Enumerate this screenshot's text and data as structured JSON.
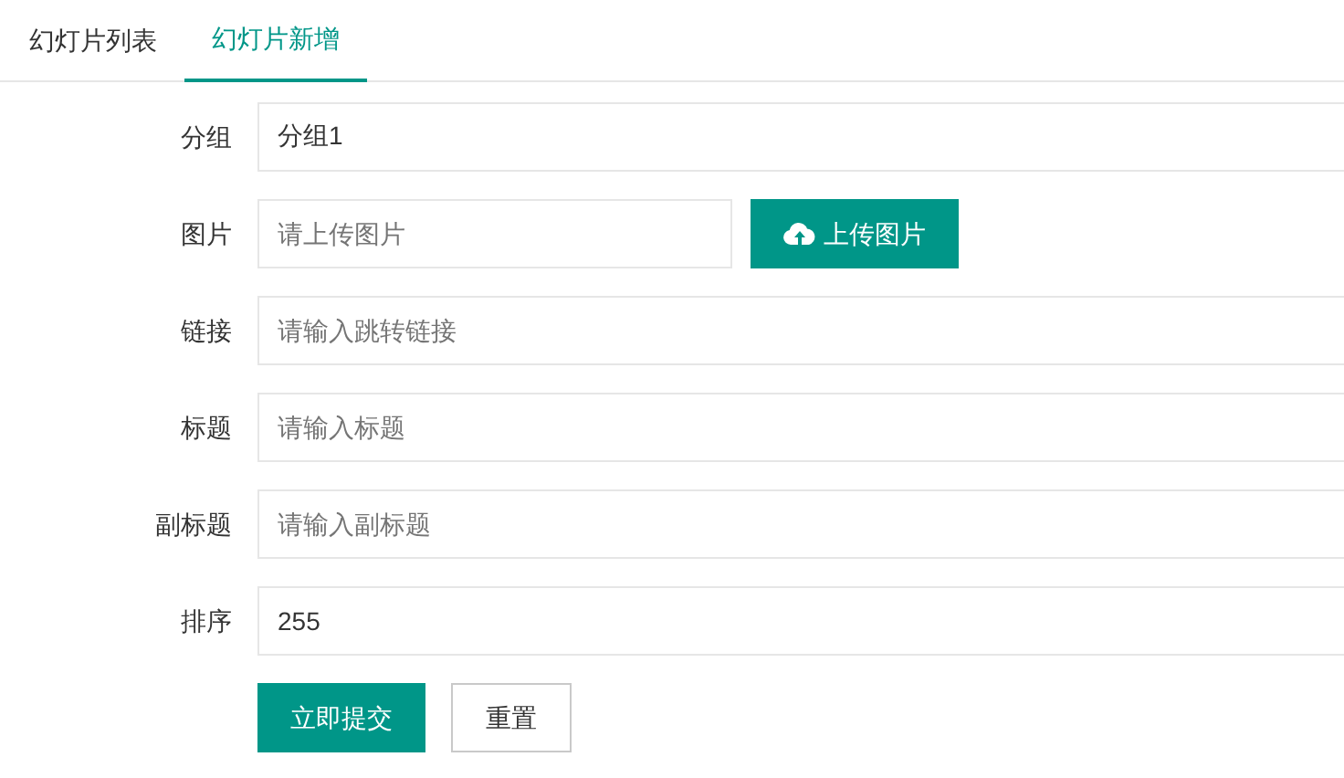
{
  "tabs": [
    {
      "label": "幻灯片列表",
      "selected": false
    },
    {
      "label": "幻灯片新增",
      "selected": true
    }
  ],
  "form": {
    "fields": [
      {
        "kind": "text",
        "label": "分组",
        "value": "分组1"
      },
      {
        "kind": "upload",
        "label": "图片",
        "placeholder": "请上传图片",
        "button": "上传图片"
      },
      {
        "kind": "text",
        "label": "链接",
        "placeholder": "请输入跳转链接"
      },
      {
        "kind": "text",
        "label": "标题",
        "placeholder": "请输入标题"
      },
      {
        "kind": "text",
        "label": "副标题",
        "placeholder": "请输入副标题"
      },
      {
        "kind": "text",
        "label": "排序",
        "value": "255"
      }
    ],
    "submit": "立即提交",
    "reset": "重置"
  }
}
